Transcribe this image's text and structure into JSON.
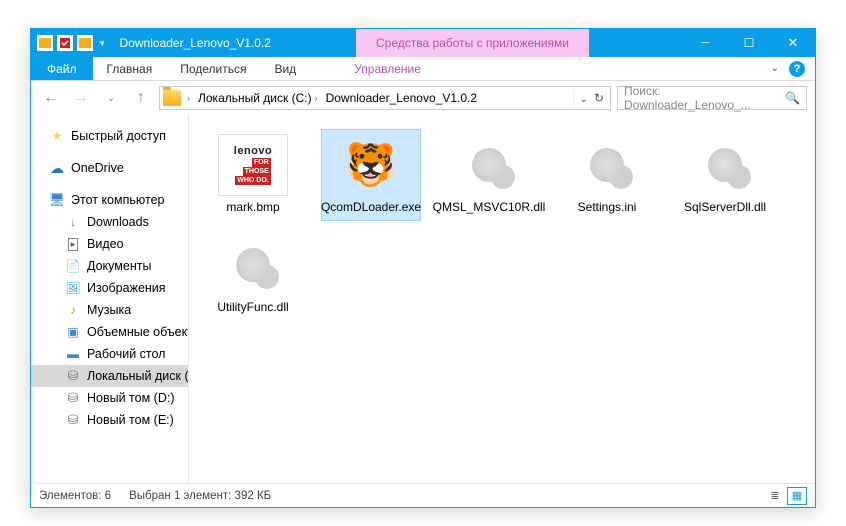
{
  "window": {
    "title": "Downloader_Lenovo_V1.0.2",
    "apptools_label": "Средства работы с приложениями"
  },
  "ribbon": {
    "file": "Файл",
    "home": "Главная",
    "share": "Поделиться",
    "view": "Вид",
    "manage": "Управление"
  },
  "breadcrumb": {
    "seg1": "Локальный диск (C:)",
    "seg2": "Downloader_Lenovo_V1.0.2"
  },
  "search": {
    "placeholder": "Поиск: Downloader_Lenovo_..."
  },
  "nav": {
    "quick": "Быстрый доступ",
    "onedrive": "OneDrive",
    "thispc": "Этот компьютер",
    "downloads": "Downloads",
    "video": "Видео",
    "docs": "Документы",
    "pics": "Изображения",
    "music": "Музыка",
    "objects": "Объемные объекты",
    "desktop": "Рабочий стол",
    "localdisk": "Локальный диск (C:)",
    "newvol_d": "Новый том (D:)",
    "newvol_e": "Новый том (E:)"
  },
  "files": {
    "f0": "mark.bmp",
    "f1": "QcomDLoader.exe",
    "f2": "QMSL_MSVC10R.dll",
    "f3": "Settings.ini",
    "f4": "SqlServerDll.dll",
    "f5": "UtilityFunc.dll"
  },
  "status": {
    "count": "Элементов: 6",
    "selection": "Выбран 1 элемент: 392 КБ"
  },
  "mark_logo": {
    "brand": "lenovo",
    "line1": "FOR",
    "line2": "THOSE",
    "line3": "WHO DO."
  }
}
